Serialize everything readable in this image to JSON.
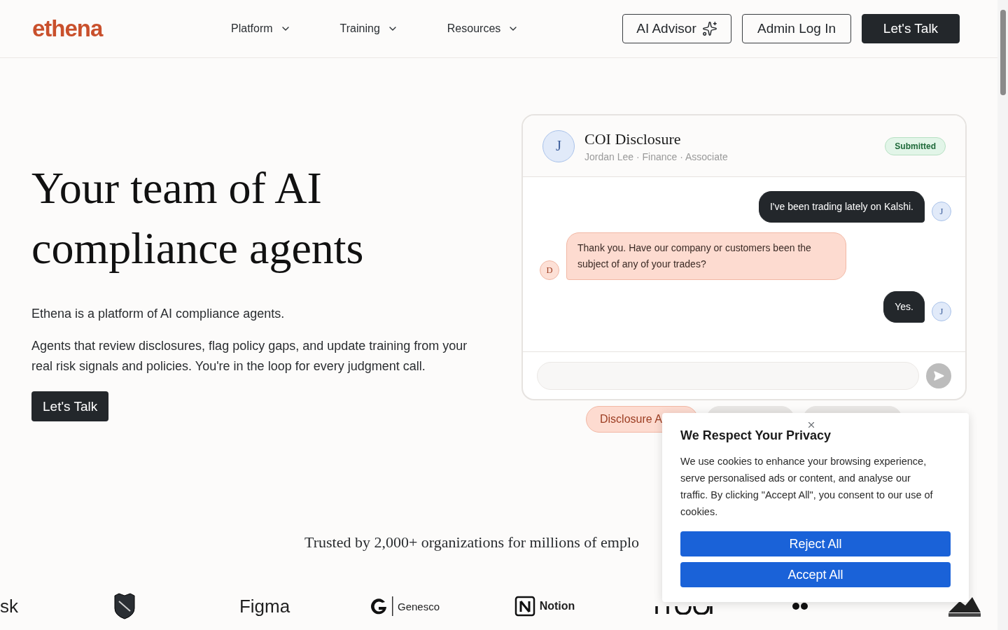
{
  "header": {
    "logo": "ethena",
    "nav": [
      {
        "label": "Platform"
      },
      {
        "label": "Training"
      },
      {
        "label": "Resources"
      }
    ],
    "buttons": [
      {
        "label": "AI Advisor",
        "kind": "advisor"
      },
      {
        "label": "Admin Log In",
        "kind": "outline"
      },
      {
        "label": "Let's Talk",
        "kind": "primary"
      }
    ]
  },
  "hero": {
    "title": "Your team of AI compliance agents",
    "lead": "Ethena is a platform of AI compliance agents.",
    "body": "Agents that review disclosures, flag policy gaps, and update training from your real risk signals and policies. You're in the loop for every judgment call.",
    "cta": "Let's Talk"
  },
  "chat": {
    "avatar": "J",
    "title": "COI Disclosure",
    "subtitle": "Jordan Lee · Finance · Associate",
    "status": "Submitted",
    "messages": [
      {
        "kind": "sent",
        "avatar": "J",
        "text": "I've been trading lately on Kalshi."
      },
      {
        "kind": "received",
        "avatar": "D",
        "text": "Thank you. Have our company or customers been the subject of any of your trades?"
      },
      {
        "kind": "sent",
        "avatar": "J",
        "text": "Yes."
      }
    ]
  },
  "chips": [
    {
      "label": "Disclosure A",
      "selected": true
    },
    {
      "selected": false
    },
    {
      "selected": false
    }
  ],
  "trusted": "Trusted by 2,000+ organizations for millions of emplo",
  "logos": [
    {
      "kind": "text",
      "label": "sk"
    },
    {
      "kind": "shield"
    },
    {
      "kind": "text",
      "label": "Figma"
    },
    {
      "kind": "genesco",
      "label": "Genesco"
    },
    {
      "kind": "notion",
      "label": "Notion"
    },
    {
      "kind": "covered"
    },
    {
      "kind": "dots"
    },
    {
      "kind": "rockies"
    }
  ],
  "cookie": {
    "title": "We Respect Your Privacy",
    "text": "We use cookies to enhance your browsing experience, serve personalised ads or content, and analyse our traffic. By clicking \"Accept All\", you consent to our use of cookies.",
    "buttons": [
      "Reject All",
      "Accept All"
    ]
  }
}
